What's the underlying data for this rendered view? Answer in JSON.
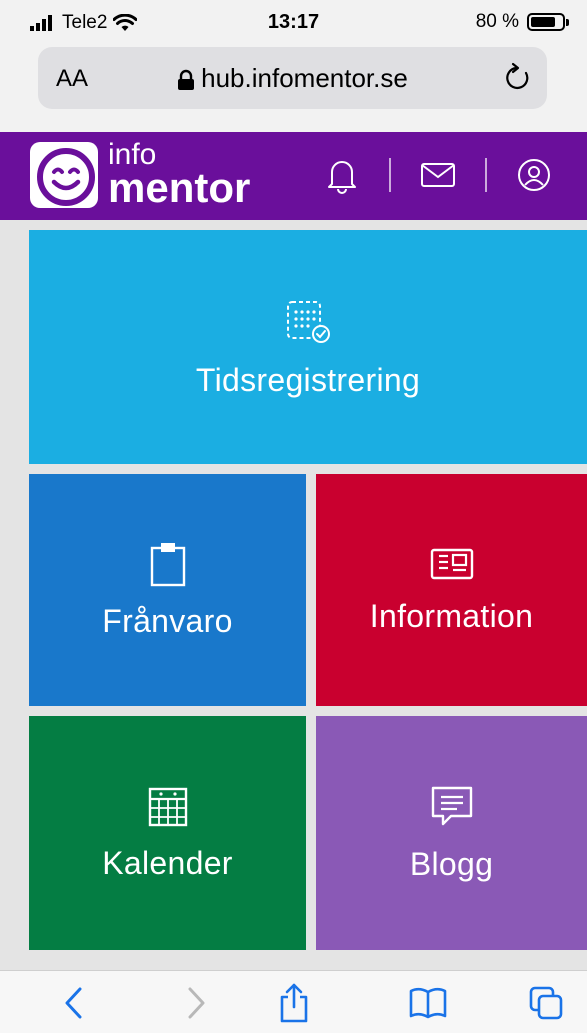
{
  "status_bar": {
    "carrier": "Tele2",
    "time": "13:17",
    "battery_text": "80 %",
    "battery_level": 0.8
  },
  "browser": {
    "text_size_label": "AA",
    "url": "hub.infomentor.se"
  },
  "app": {
    "brand_top": "info",
    "brand_bottom": "mentor",
    "colors": {
      "header": "#6a0f9b"
    }
  },
  "tiles": [
    {
      "label": "Tidsregistrering",
      "icon": "calendar-check-icon",
      "color": "#1baee2"
    },
    {
      "label": "Frånvaro",
      "icon": "clipboard-icon",
      "color": "#1978cb"
    },
    {
      "label": "Information",
      "icon": "newspaper-icon",
      "color": "#c9002f"
    },
    {
      "label": "Kalender",
      "icon": "calendar-icon",
      "color": "#047d43"
    },
    {
      "label": "Blogg",
      "icon": "chat-bubble-icon",
      "color": "#8a59b6"
    }
  ],
  "toolbar": {
    "icons": [
      "back-icon",
      "forward-icon",
      "share-icon",
      "bookmarks-icon",
      "tabs-icon"
    ]
  }
}
